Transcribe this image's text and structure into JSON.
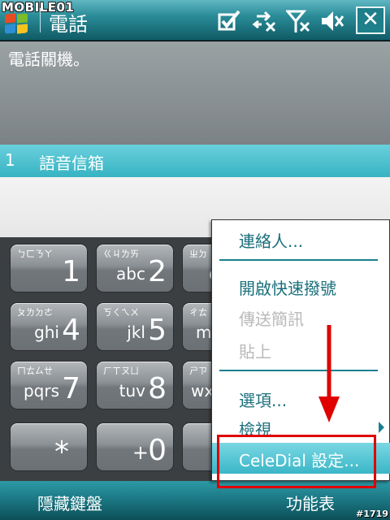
{
  "watermark": "MOBILE01",
  "image_number": "#1719",
  "titlebar": {
    "title": "電話",
    "tray_icons": [
      "checkbox-icon",
      "sync-icon",
      "signal-off-icon",
      "volume-mute-icon"
    ],
    "close_label": "✕"
  },
  "status": {
    "text": "電話關機。"
  },
  "voicemail": {
    "number": "1",
    "label": "語音信箱"
  },
  "keypad": [
    {
      "bopomofo": "ㄅㄈㄋㄚ",
      "letters": "",
      "digit": "1"
    },
    {
      "bopomofo": "ㄍㄐㄌㄞ",
      "letters": "abc",
      "digit": "2"
    },
    {
      "bopomofo": "ㄓㄉ",
      "letters": "d",
      "digit": ""
    },
    {
      "bopomofo": "ㄆㄌㄉㄜ",
      "letters": "ghi",
      "digit": "4"
    },
    {
      "bopomofo": "ㄎㄑㄟㄨ",
      "letters": "jkl",
      "digit": "5"
    },
    {
      "bopomofo": "ㄔㄊ",
      "letters": "m",
      "digit": ""
    },
    {
      "bopomofo": "ㄇㄊㄙㄝ",
      "letters": "pqrs",
      "digit": "7"
    },
    {
      "bopomofo": "ㄏㄒㄡㄩ",
      "letters": "tuv",
      "digit": "8"
    },
    {
      "bopomofo": "ㄕㄗ",
      "letters": "wx",
      "digit": ""
    },
    {
      "bopomofo": "",
      "letters": "",
      "digit": "*"
    },
    {
      "bopomofo": "",
      "letters": "+",
      "digit": "0"
    }
  ],
  "softkeys": {
    "left": "隱藏鍵盤",
    "right": "功能表"
  },
  "menu": {
    "items": [
      {
        "label": "連絡人...",
        "enabled": true
      },
      {
        "label": "開啟快速撥號",
        "enabled": true
      },
      {
        "label": "傳送簡訊",
        "enabled": false
      },
      {
        "label": "貼上",
        "enabled": false
      },
      {
        "label": "選項...",
        "enabled": true
      },
      {
        "label": "檢視",
        "enabled": true
      },
      {
        "label": "CeleDial 設定...",
        "enabled": true,
        "selected": true
      }
    ]
  },
  "colors": {
    "accent": "#36b3c3",
    "titlebar": "#1f7f8a",
    "menu_text": "#1a6f7c",
    "disabled_text": "#b9b9b9",
    "annotation": "#e00000"
  }
}
